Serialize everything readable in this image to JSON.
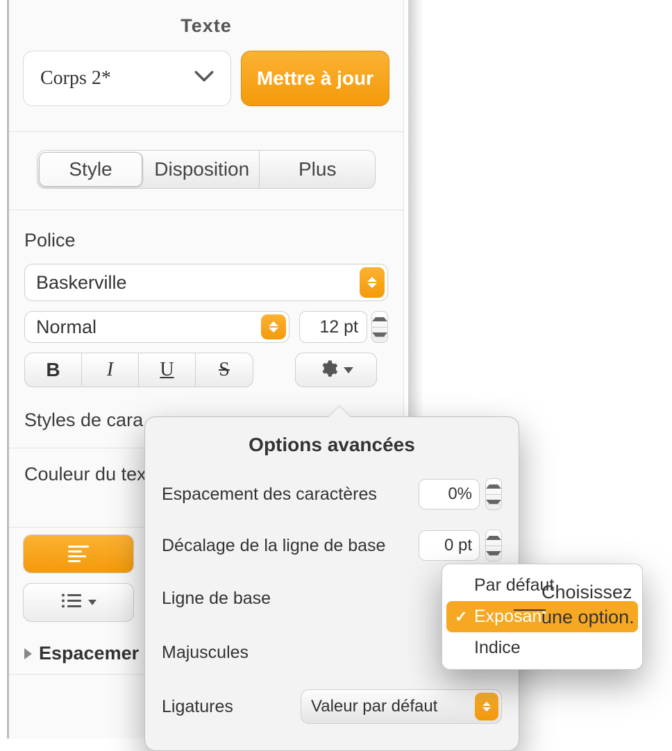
{
  "panel_title": "Texte",
  "paragraph_style": {
    "value": "Corps 2*",
    "update_label": "Mettre à jour"
  },
  "tabs": {
    "style": "Style",
    "layout": "Disposition",
    "more": "Plus"
  },
  "font": {
    "section_label": "Police",
    "family": "Baskerville",
    "weight": "Normal",
    "size": "12 pt"
  },
  "char_styles_label": "Styles de cara",
  "text_color_label": "Couleur du tex",
  "spacing_label": "Espacemer",
  "popover": {
    "title": "Options avancées",
    "char_spacing_label": "Espacement des caractères",
    "char_spacing_value": "0%",
    "baseline_shift_label": "Décalage de la ligne de base",
    "baseline_shift_value": "0 pt",
    "baseline_label": "Ligne de base",
    "caps_label": "Majuscules",
    "ligatures_label": "Ligatures",
    "ligatures_value": "Valeur par défaut"
  },
  "menu": {
    "default": "Par défaut",
    "superscript": "Exposant",
    "subscript": "Indice"
  },
  "callout": {
    "line1": "Choisissez",
    "line2": "une option."
  }
}
